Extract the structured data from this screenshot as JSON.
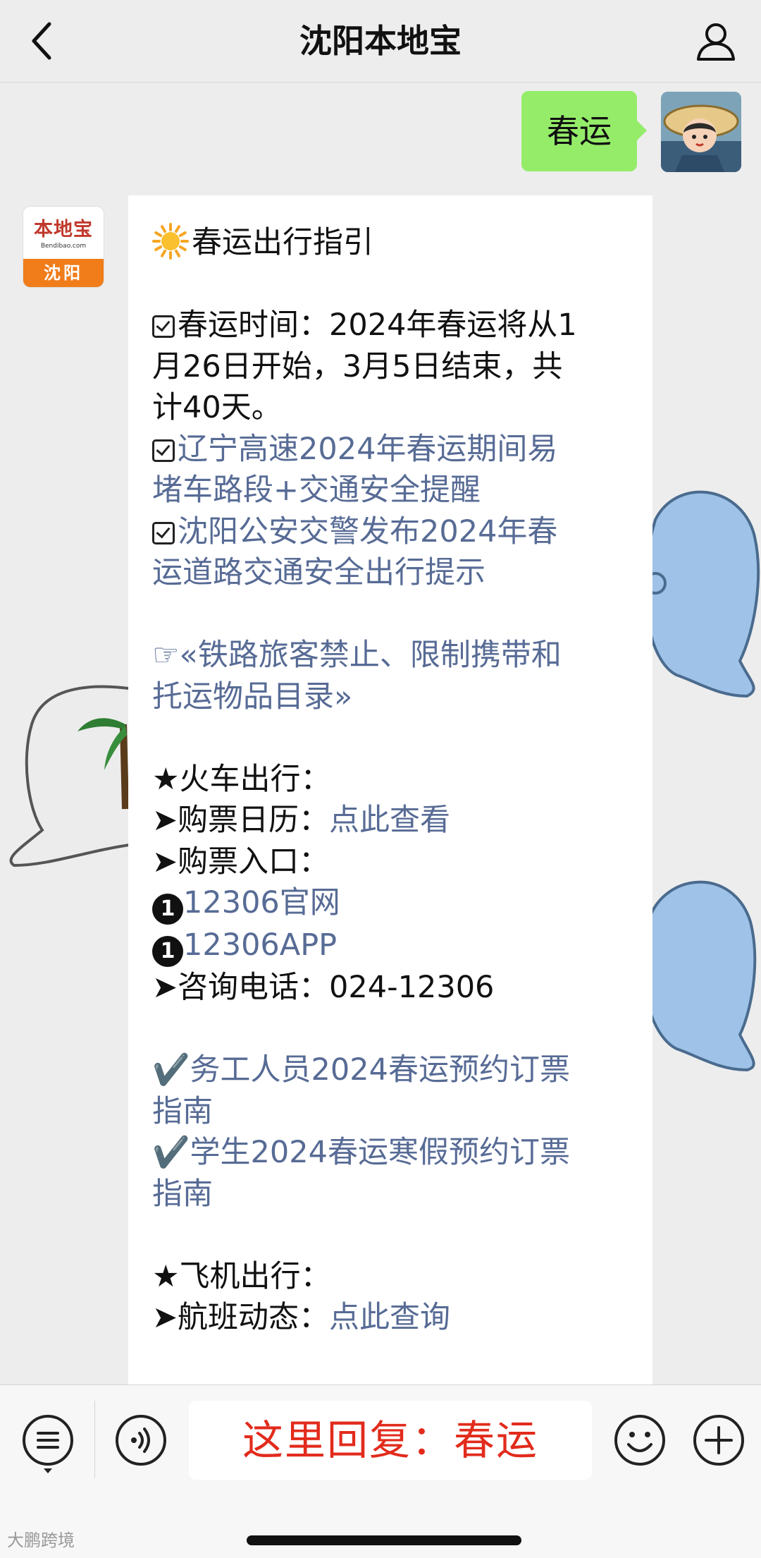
{
  "navbar": {
    "title": "沈阳本地宝",
    "back_icon": "chevron-left-icon",
    "profile_icon": "person-icon"
  },
  "user_message": {
    "text": "春运"
  },
  "bot": {
    "logo_main": "本地宝",
    "logo_sub": "Bendibao.com",
    "logo_city": "沈阳"
  },
  "message": {
    "lines": [
      {
        "kind": "title",
        "text": "春运出行指引"
      },
      {
        "kind": "blank"
      },
      {
        "kind": "check",
        "text": "春运时间：2024年春运将从1"
      },
      {
        "kind": "plain",
        "text": "月26日开始，3月5日结束，共"
      },
      {
        "kind": "plain",
        "text": "计40天。"
      },
      {
        "kind": "check-link",
        "text": "辽宁高速2024年春运期间易"
      },
      {
        "kind": "link",
        "text": "堵车路段+交通安全提醒"
      },
      {
        "kind": "check-link",
        "text": "沈阳公安交警发布2024年春"
      },
      {
        "kind": "link",
        "text": "运道路交通安全出行提示"
      },
      {
        "kind": "blank"
      },
      {
        "kind": "link",
        "text": "☞«铁路旅客禁止、限制携带和"
      },
      {
        "kind": "link",
        "text": "托运物品目录»"
      },
      {
        "kind": "blank"
      },
      {
        "kind": "plain",
        "text": "★火车出行："
      },
      {
        "kind": "label-link",
        "label": "➤购票日历：",
        "text": "点此查看"
      },
      {
        "kind": "plain",
        "text": "➤购票入口："
      },
      {
        "kind": "num-link",
        "num": "1",
        "text": "12306官网"
      },
      {
        "kind": "num-link",
        "num": "1",
        "text": "12306APP"
      },
      {
        "kind": "plain",
        "text": "➤咨询电话：024-12306"
      },
      {
        "kind": "blank"
      },
      {
        "kind": "link",
        "text": "✔️务工人员2024春运预约订票"
      },
      {
        "kind": "link",
        "text": "指南"
      },
      {
        "kind": "link",
        "text": "✔️学生2024春运寒假预约订票"
      },
      {
        "kind": "link",
        "text": "指南"
      },
      {
        "kind": "blank"
      },
      {
        "kind": "plain",
        "text": "★飞机出行："
      },
      {
        "kind": "label-link",
        "label": "➤航班动态：",
        "text": "点此查询"
      }
    ]
  },
  "bottom": {
    "reply_hint": "这里回复：春运",
    "menu_icon": "menu-list-icon",
    "voice_icon": "voice-icon",
    "emoji_icon": "emoji-icon",
    "plus_icon": "plus-icon",
    "watermark": "大鹏跨境"
  },
  "colors": {
    "link": "#576b95",
    "user_bubble": "#95ec69",
    "reply_text": "#e22b1c"
  }
}
